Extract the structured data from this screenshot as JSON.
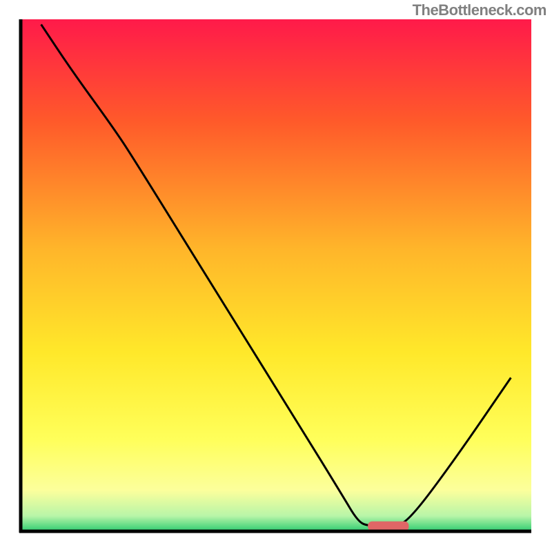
{
  "watermark": "TheBottleneck.com",
  "chart_data": {
    "type": "line",
    "title": "",
    "xlabel": "",
    "ylabel": "",
    "xlim": [
      0,
      100
    ],
    "ylim": [
      0,
      100
    ],
    "background_gradient": {
      "top": "#ff1a4a",
      "upper_mid": "#ff8c2a",
      "mid": "#ffd92a",
      "lower_mid": "#ffff6a",
      "lower": "#fdff9c",
      "bottom": "#2ecc71"
    },
    "series": [
      {
        "name": "bottleneck-curve",
        "color": "#000000",
        "points": [
          {
            "x": 4,
            "y": 99
          },
          {
            "x": 10,
            "y": 90
          },
          {
            "x": 18,
            "y": 79
          },
          {
            "x": 22,
            "y": 73
          },
          {
            "x": 40,
            "y": 44
          },
          {
            "x": 55,
            "y": 20
          },
          {
            "x": 63,
            "y": 7
          },
          {
            "x": 66,
            "y": 2
          },
          {
            "x": 68,
            "y": 1
          },
          {
            "x": 73,
            "y": 1
          },
          {
            "x": 76,
            "y": 2
          },
          {
            "x": 85,
            "y": 14
          },
          {
            "x": 96,
            "y": 30
          }
        ]
      }
    ],
    "marker": {
      "name": "optimal-marker",
      "color": "#e06666",
      "x_start": 68,
      "x_end": 76,
      "y": 1
    },
    "axes": {
      "left": true,
      "bottom": true,
      "color": "#000000",
      "stroke_width": 5
    }
  }
}
